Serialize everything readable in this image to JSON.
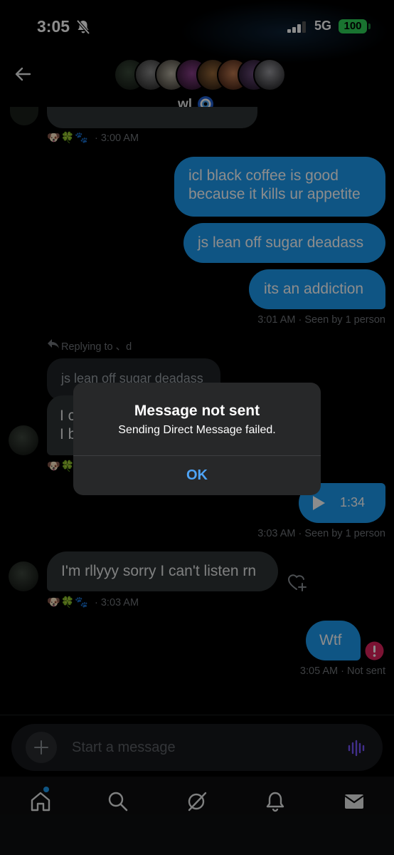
{
  "status_bar": {
    "time": "3:05",
    "network": "5G",
    "battery": "100"
  },
  "header": {
    "group_name": "wl",
    "avatar_count": 7
  },
  "messages": {
    "top_reactions": "🐶🍀🐾",
    "top_time": "· 3:00 AM",
    "out1": "icl black coffee is good because it kills ur appetite",
    "out2": "js lean off sugar deadass",
    "out3": "its an addiction",
    "out3_meta": "3:01 AM · Seen by 1 person",
    "reply_context": "Replying to 、d",
    "quoted": "js lean off sugar deadass",
    "hidden_reply_line1": "I c",
    "hidden_reply_line2": "I b",
    "audio_duration": "1:34",
    "audio_meta": "3:03 AM · Seen by 1 person",
    "in2": "I'm rllyyy sorry I can't listen rn",
    "in2_reactions": "🐶🍀🐾",
    "in2_time": "· 3:03 AM",
    "out4": "Wtf",
    "out4_meta": "3:05 AM · Not sent"
  },
  "dialog": {
    "title": "Message not sent",
    "message": "Sending Direct Message failed.",
    "ok_label": "OK"
  },
  "composer": {
    "placeholder": "Start a message"
  },
  "tabs": [
    "home-icon",
    "search-icon",
    "grok-icon",
    "bell-icon",
    "mail-icon"
  ],
  "colors": {
    "accent": "#1d9bf0",
    "incoming": "#2f3336",
    "error": "#e0245e",
    "voice": "#7856ff"
  }
}
